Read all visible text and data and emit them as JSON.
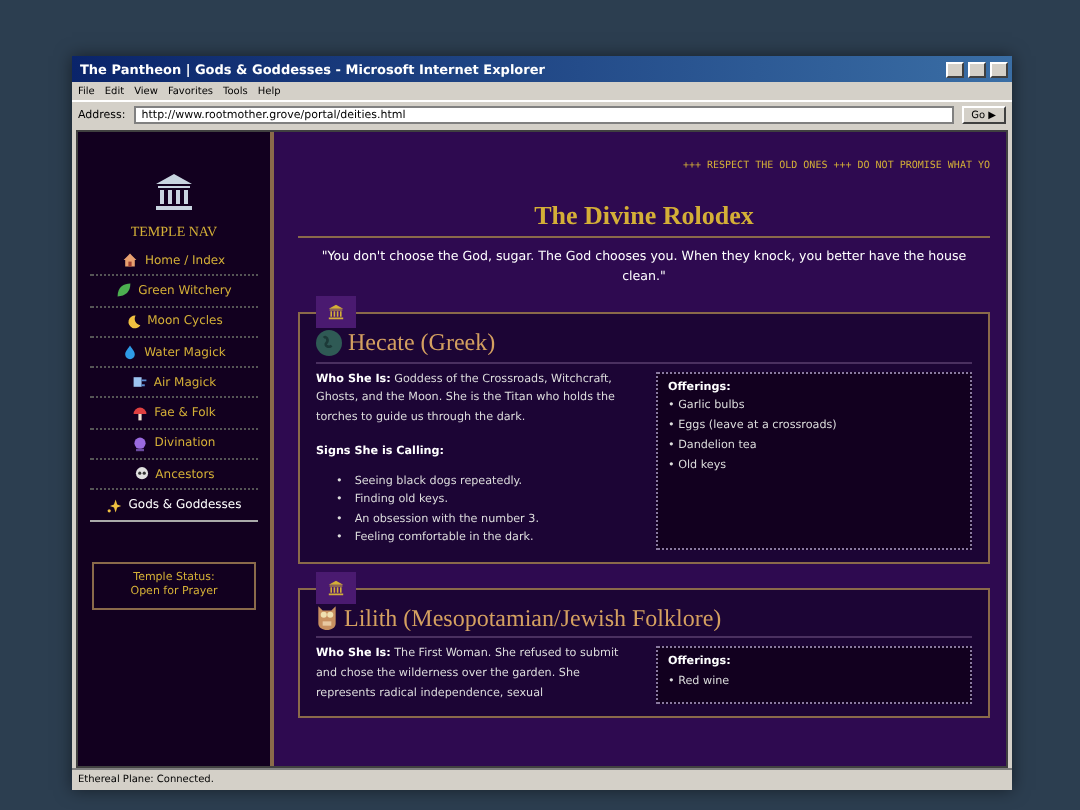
{
  "window": {
    "title": "The Pantheon | Gods & Goddesses - Microsoft Internet Explorer"
  },
  "menu": [
    "File",
    "Edit",
    "View",
    "Favorites",
    "Tools",
    "Help"
  ],
  "address": {
    "label": "Address:",
    "value": "http://www.rootmother.grove/portal/deities.html",
    "go": "Go ▶"
  },
  "sidebar": {
    "title": "TEMPLE NAV",
    "items": [
      {
        "label": "Home / Index",
        "kind": "home",
        "selected": false
      },
      {
        "label": "Green Witchery",
        "kind": "leaf",
        "selected": false
      },
      {
        "label": "Moon Cycles",
        "kind": "moon",
        "selected": false
      },
      {
        "label": "Water Magick",
        "kind": "drop",
        "selected": false
      },
      {
        "label": "Air Magick",
        "kind": "wind",
        "selected": false
      },
      {
        "label": "Fae & Folk",
        "kind": "mushroom",
        "selected": false
      },
      {
        "label": "Divination",
        "kind": "orb",
        "selected": false
      },
      {
        "label": "Ancestors",
        "kind": "skull",
        "selected": false
      },
      {
        "label": "Gods & Goddesses",
        "kind": "sparkle",
        "selected": true
      }
    ],
    "status_box": [
      "Temple Status:",
      "Open for Prayer"
    ]
  },
  "marquee": "+++ RESPECT THE OLD ONES +++ DO NOT PROMISE WHAT YO",
  "heading": "The Divine Rolodex",
  "quote": "\"You don't choose the God, sugar. The God chooses you. When they knock, you better have the house clean.\"",
  "deities": [
    {
      "name": "Hecate (Greek)",
      "kind": "globe",
      "who": "**Who She Is:** Goddess of the Crossroads, Witchcraft, Ghosts, and the Moon. She is the Titan who holds the torches to guide us through the dark.",
      "bullet": "•",
      "signs_title": "Signs She is Calling:",
      "signs": [
        "Seeing black dogs repeatedly.",
        "Finding old keys.",
        "An obsession with the number 3.",
        "Feeling comfortable in the dark."
      ],
      "offerings_title": "Offerings:",
      "offerings": [
        "Garlic bulbs",
        "Eggs (leave at a crossroads)",
        "Dandelion tea",
        "Old keys"
      ]
    },
    {
      "name": "Lilith (Mesopotamian/Jewish Folklore)",
      "kind": "owl",
      "who": "**Who She Is:** The First Woman. She refused to submit and chose the wilderness over the garden. She represents radical independence, sexual",
      "bullet": "•",
      "offerings_title": "Offerings:",
      "offerings": [
        "Red wine"
      ]
    }
  ],
  "status_bar": "Ethereal Plane: Connected."
}
